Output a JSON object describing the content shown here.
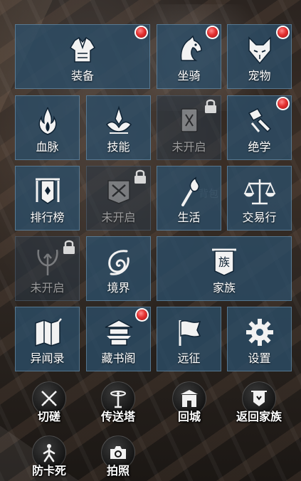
{
  "menu": {
    "tiles": [
      {
        "label": "装备",
        "icon": "armor-icon",
        "badge": true,
        "locked": false
      },
      {
        "label": "坐骑",
        "icon": "horse-head-icon",
        "badge": true,
        "locked": false
      },
      {
        "label": "宠物",
        "icon": "fox-mask-icon",
        "badge": true,
        "locked": false
      },
      {
        "label": "血脉",
        "icon": "bloodline-flame-icon",
        "badge": false,
        "locked": false
      },
      {
        "label": "技能",
        "icon": "skill-lotus-icon",
        "badge": false,
        "locked": false
      },
      {
        "label": "未开启",
        "icon": "card-icon",
        "badge": false,
        "locked": true
      },
      {
        "label": "绝学",
        "icon": "scroll-brush-icon",
        "badge": true,
        "locked": false
      },
      {
        "label": "排行榜",
        "icon": "ranking-banner-icon",
        "badge": false,
        "locked": false
      },
      {
        "label": "未开启",
        "icon": "crossed-swords-banner-icon",
        "badge": false,
        "locked": true
      },
      {
        "label": "生活",
        "icon": "torch-icon",
        "badge": false,
        "locked": false
      },
      {
        "label": "交易行",
        "icon": "scales-icon",
        "badge": false,
        "locked": false
      },
      {
        "label": "未开启",
        "icon": "trident-icon",
        "badge": false,
        "locked": true
      },
      {
        "label": "境界",
        "icon": "realm-swirl-icon",
        "badge": false,
        "locked": false
      },
      {
        "label": "家族",
        "icon": "clan-banner-icon",
        "badge": false,
        "locked": false,
        "banner_char": "族"
      },
      {
        "label": "异闻录",
        "icon": "map-book-icon",
        "badge": false,
        "locked": false
      },
      {
        "label": "藏书阁",
        "icon": "pavilion-icon",
        "badge": true,
        "locked": false
      },
      {
        "label": "远征",
        "icon": "flag-icon",
        "badge": false,
        "locked": false
      },
      {
        "label": "设置",
        "icon": "gear-icon",
        "badge": false,
        "locked": false
      }
    ]
  },
  "background_text": "背包",
  "actions": [
    {
      "label": "切磋",
      "icon": "crossed-swords-icon"
    },
    {
      "label": "传送塔",
      "icon": "teleport-tower-icon"
    },
    {
      "label": "回城",
      "icon": "city-gate-icon"
    },
    {
      "label": "返回家族",
      "icon": "clan-shield-icon"
    },
    {
      "label": "防卡死",
      "icon": "unstuck-figure-icon"
    },
    {
      "label": "拍照",
      "icon": "camera-icon"
    }
  ],
  "colors": {
    "tile_bg": "#2b4e69",
    "badge": "#e43030",
    "text": "#ffffff"
  }
}
